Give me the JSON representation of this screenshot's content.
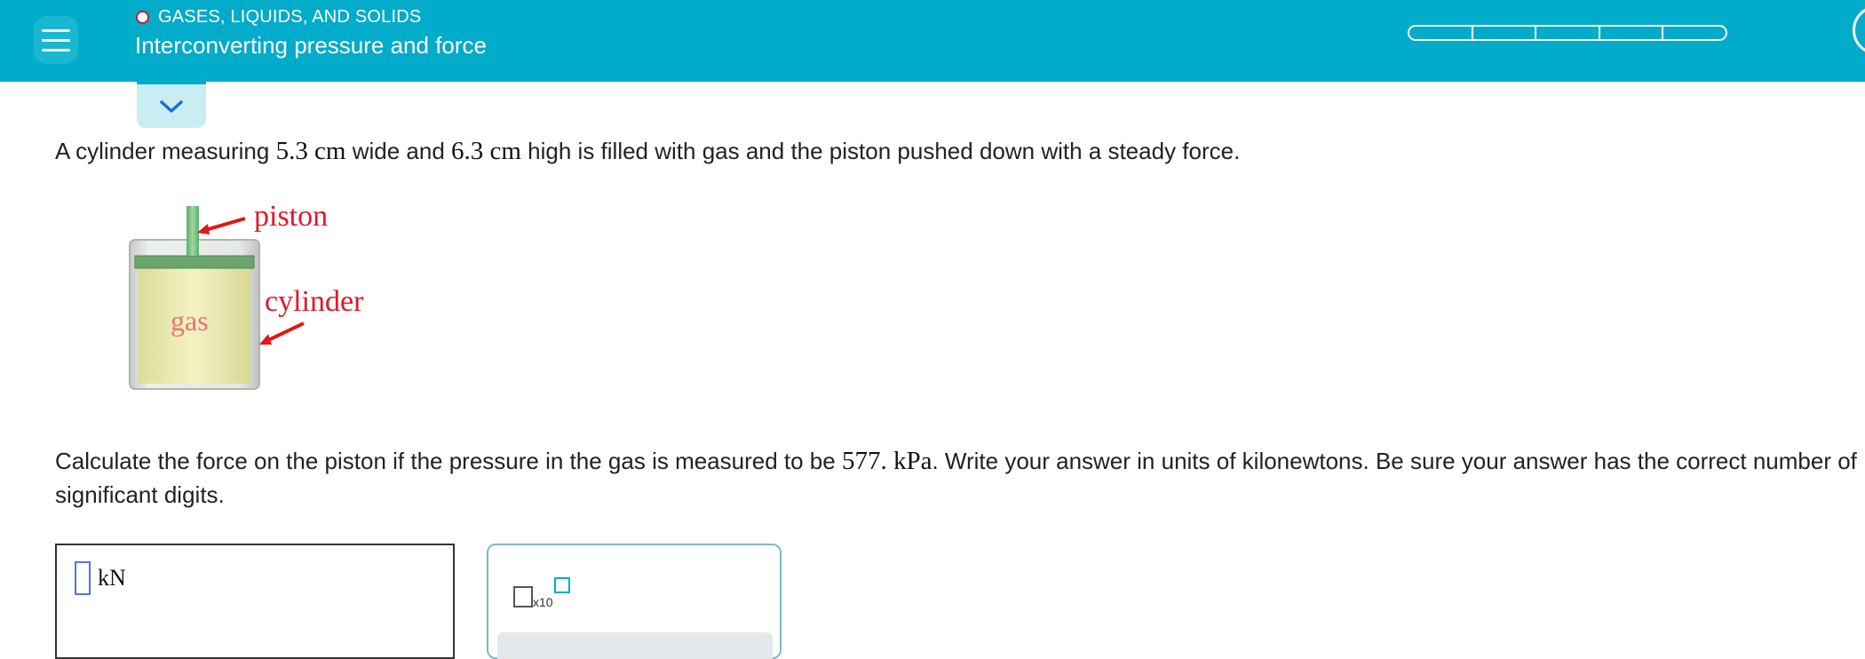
{
  "header": {
    "topic": "GASES, LIQUIDS, AND SOLIDS",
    "title": "Interconverting pressure and force",
    "progress_segments": 5,
    "colors": {
      "bar": "#00acc9",
      "status_circle": "#c41e3a"
    }
  },
  "question": {
    "intro_before_width": "A cylinder measuring ",
    "width_value": "5.3",
    "width_unit": "cm",
    "between": " wide and ",
    "height_value": "6.3",
    "height_unit": "cm",
    "intro_after": " high is filled with gas and the piston pushed down with a steady force.",
    "task_before": "Calculate the force on the piston if the pressure in the gas is measured to be ",
    "pressure_value": "577.",
    "pressure_unit": "kPa",
    "task_after": ". Write your answer in units of kilonewtons. Be sure your answer has the correct number of significant digits."
  },
  "diagram": {
    "label_piston": "piston",
    "label_cylinder": "cylinder",
    "label_gas": "gas"
  },
  "answer": {
    "unit": "kN",
    "value": ""
  },
  "tools": {
    "sci_notation_label": "x10"
  }
}
